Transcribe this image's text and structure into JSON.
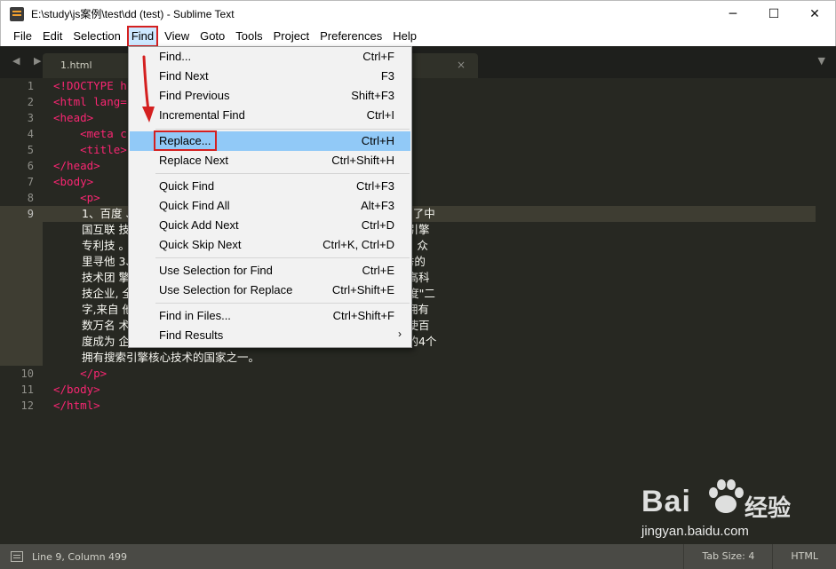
{
  "window": {
    "title": "E:\\study\\js案例\\test\\dd (test) - Sublime Text",
    "controls": [
      "─",
      "☐",
      "✕"
    ]
  },
  "menubar": {
    "items": [
      "File",
      "Edit",
      "Selection",
      "Find",
      "View",
      "Goto",
      "Tools",
      "Project",
      "Preferences",
      "Help"
    ],
    "active": "Find"
  },
  "tabs": {
    "nav": "◀ ▶",
    "active_tab": "1.html",
    "close": "×",
    "dropdown": "▼"
  },
  "editor": {
    "line_numbers": [
      "1",
      "2",
      "3",
      "4",
      "5",
      "6",
      "7",
      "8",
      "9",
      "10",
      "11",
      "12"
    ],
    "current_line": "9",
    "code": {
      "l1": "<!DOCTYPE h",
      "l2": "<html lang=",
      "l3": "<head>",
      "l4": "    <meta c",
      "l5": "    <title>",
      "l6": "</head>",
      "l7": "<body>",
      "l8": "    <p>",
      "l10": "    </p>",
      "l11": "</body>",
      "l12": "</html>"
    },
    "paragraph_lines": [
      "1、百度                                     、最大的中文网站。1999年底,身在美国硅谷的李彦宏看到了中",
      "国互联                                     技术改变世界的梦想，他毅然辞掉硅谷的高薪工作，携搜索引擎",
      "专利技                                     。2、\"百度\"二字,来自于八百年前南宋词人辛弃疾的一句词：众",
      "里寻他                                     3、百度拥有数万名研发工程师，这是中国乃至全球最为优秀的",
      "技术团                                     擎技术，使百度成为中国掌握世界尖端科学核心技术的中国高科",
      "技企业,                                    全球仅有的4个拥有搜索引擎核心技术的国家之一。4、\"百度\"二",
      "字,来自                                    他千百度。这句话描述了词人对理想的执着追求。5、百度拥有",
      "数万名                                     术团队。这支队伍掌握着世界上最为先进的搜索引擎技术，使百",
      "度成为                                     企业，也使中国成为美国、俄罗斯、和韩国之外，全球仅有的4个",
      "拥有搜索引擎核心技术的国家之一。"
    ]
  },
  "find_menu": {
    "items": [
      {
        "label": "Find...",
        "shortcut": "Ctrl+F"
      },
      {
        "label": "Find Next",
        "shortcut": "F3"
      },
      {
        "label": "Find Previous",
        "shortcut": "Shift+F3"
      },
      {
        "label": "Incremental Find",
        "shortcut": "Ctrl+I"
      },
      {
        "label": "Replace...",
        "shortcut": "Ctrl+H"
      },
      {
        "label": "Replace Next",
        "shortcut": "Ctrl+Shift+H"
      },
      {
        "label": "Quick Find",
        "shortcut": "Ctrl+F3"
      },
      {
        "label": "Quick Find All",
        "shortcut": "Alt+F3"
      },
      {
        "label": "Quick Add Next",
        "shortcut": "Ctrl+D"
      },
      {
        "label": "Quick Skip Next",
        "shortcut": "Ctrl+K, Ctrl+D"
      },
      {
        "label": "Use Selection for Find",
        "shortcut": "Ctrl+E"
      },
      {
        "label": "Use Selection for Replace",
        "shortcut": "Ctrl+Shift+E"
      },
      {
        "label": "Find in Files...",
        "shortcut": "Ctrl+Shift+F"
      },
      {
        "label": "Find Results",
        "shortcut": "›"
      }
    ],
    "highlighted": "Replace..."
  },
  "statusbar": {
    "position": "Line 9, Column 499",
    "tab_size": "Tab Size: 4",
    "syntax": "HTML"
  },
  "watermark": {
    "brand": "Bai",
    "brand2": "经验",
    "url": "jingyan.baidu.com"
  },
  "colors": {
    "editor_bg": "#272822",
    "tag": "#f92672",
    "highlight": "#91c9f7",
    "annotation_red": "#d42020"
  }
}
